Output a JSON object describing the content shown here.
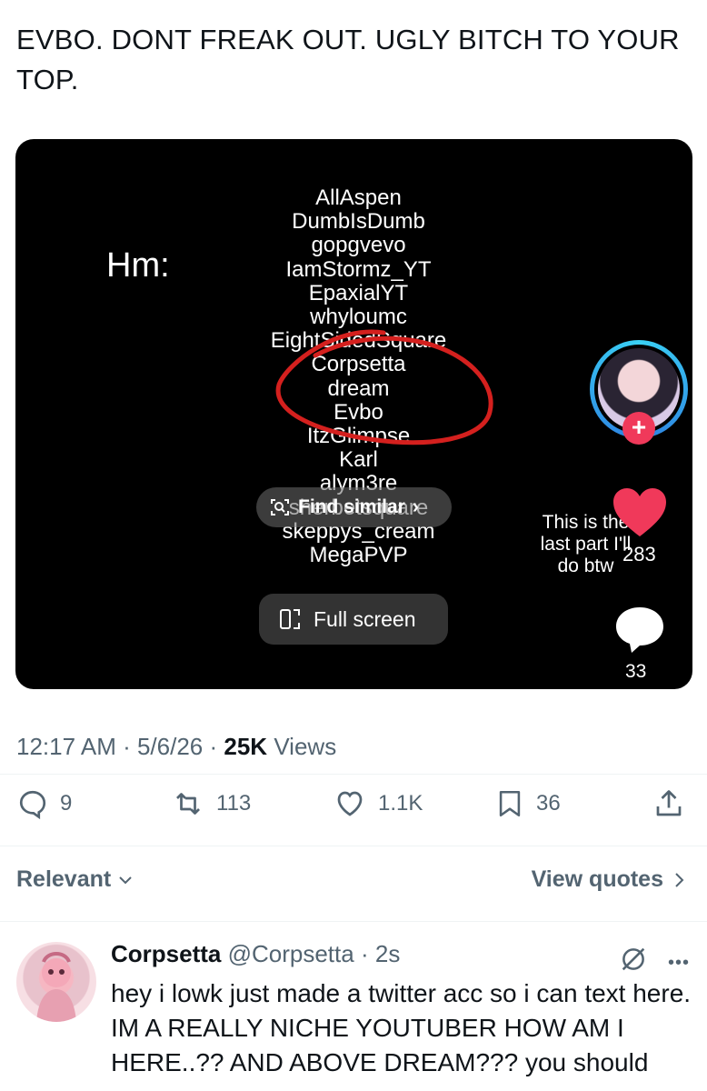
{
  "tweet": {
    "text": "EVBO. DONT FREAK OUT. UGLY BITCH TO YOUR TOP."
  },
  "video": {
    "overlay_label": "Hm:",
    "names": [
      "AllAspen",
      "DumbIsDumb",
      "gopgvevo",
      "IamStormz_YT",
      "EpaxialYT",
      "whyloumc",
      "EightSidedSquare",
      "Corpsetta",
      "dream",
      "Evbo",
      "ItzGlimpse",
      "Karl",
      "alym3re",
      "sherbetsquare",
      "skeppys_cream",
      "MegaPVP"
    ],
    "find_similar_label": "Find similar",
    "full_screen_label": "Full screen",
    "caption": "This is the last part I'll do btw",
    "like_count": "283",
    "comment_count": "33"
  },
  "meta": {
    "time": "12:17 AM",
    "date": "5/6/26",
    "views_count": "25K",
    "views_label": "Views"
  },
  "actions": {
    "replies": "9",
    "reposts": "113",
    "likes": "1.1K",
    "bookmarks": "36"
  },
  "filters": {
    "sort_label": "Relevant",
    "view_quotes_label": "View quotes"
  },
  "reply": {
    "name": "Corpsetta",
    "handle": "@Corpsetta",
    "age": "2s",
    "text": "hey i lowk just made a twitter acc so i can text here. IM A REALLY NICHE YOUTUBER HOW AM I HERE..?? AND ABOVE DREAM??? you should"
  },
  "colors": {
    "accent_red": "#f0395a",
    "muted": "#536471",
    "circle_marker": "#d4201e"
  }
}
